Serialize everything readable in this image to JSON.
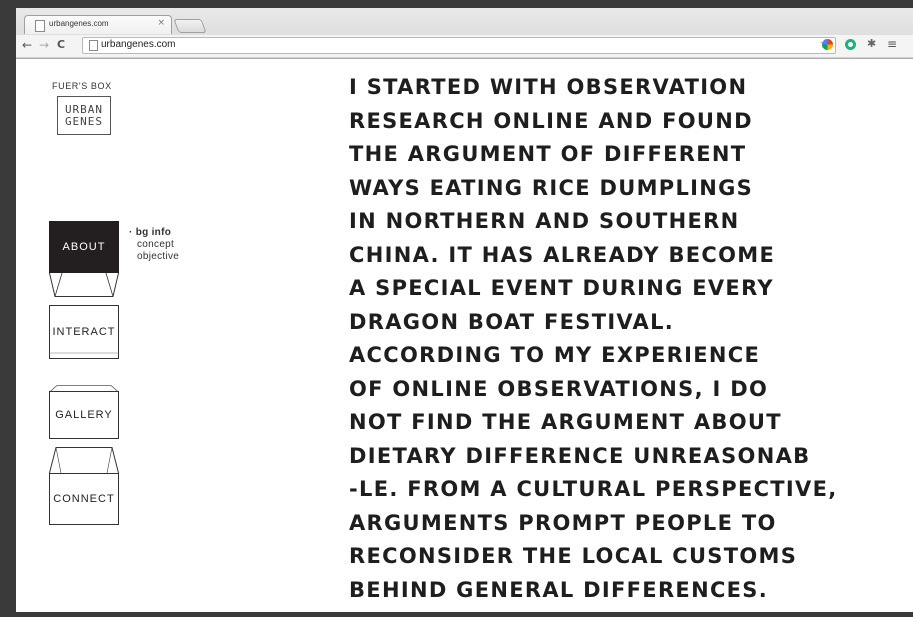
{
  "browser": {
    "tab_title": "urbangenes.com",
    "tab_close": "×",
    "url": "urbangenes.com",
    "nav": {
      "back": "←",
      "forward": "→",
      "reload": "C"
    },
    "star": "☆",
    "extension_icons": [
      "chrome-color-icon",
      "green-circle-icon",
      "puzzle-icon"
    ],
    "menu": "≡"
  },
  "sidebar": {
    "brand_caption": "FUER'S BOX",
    "logo_lines": [
      "URBAN",
      "GENES"
    ],
    "nav": [
      {
        "label": "ABOUT",
        "active": true
      },
      {
        "label": "INTERACT",
        "active": false
      },
      {
        "label": "GALLERY",
        "active": false
      },
      {
        "label": "CONNECT",
        "active": false
      }
    ],
    "subnav": [
      "· bg info",
      "concept",
      "objective"
    ]
  },
  "main": {
    "lines": [
      "I STARTED WITH OBSERVATION",
      "RESEARCH ONLINE AND FOUND",
      "THE ARGUMENT OF DIFFERENT",
      "WAYS EATING RICE DUMPLINGS",
      "IN NORTHERN AND SOUTHERN",
      "CHINA. IT HAS ALREADY BECOME",
      "A SPECIAL EVENT DURING EVERY",
      "DRAGON BOAT FESTIVAL.",
      "ACCORDING TO MY EXPERIENCE",
      "OF ONLINE OBSERVATIONS, I DO",
      "NOT FIND THE ARGUMENT ABOUT",
      "DIETARY DIFFERENCE UNREASONAB",
      "-LE. FROM A CULTURAL PERSPECTIVE,",
      "ARGUMENTS PROMPT PEOPLE TO",
      "RECONSIDER THE LOCAL CUSTOMS",
      "BEHIND GENERAL DIFFERENCES."
    ]
  },
  "colors": {
    "active_card": "#231f20",
    "text": "#1e1e1e",
    "frame": "#3a3a3a"
  }
}
